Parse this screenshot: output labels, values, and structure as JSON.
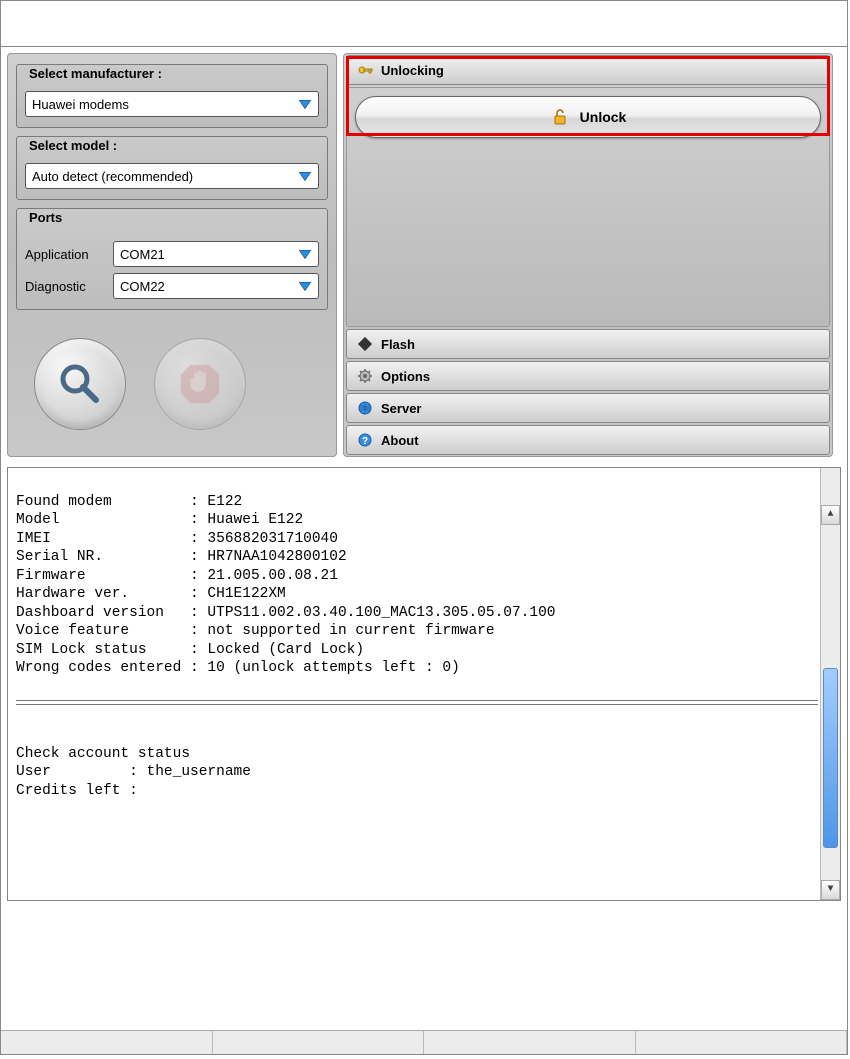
{
  "left": {
    "manufacturer": {
      "label": "Select manufacturer :",
      "value": "Huawei modems"
    },
    "model": {
      "label": "Select model :",
      "value": "Auto detect (recommended)"
    },
    "ports": {
      "label": "Ports",
      "application": {
        "label": "Application",
        "value": "COM21"
      },
      "diagnostic": {
        "label": "Diagnostic",
        "value": "COM22"
      }
    }
  },
  "right": {
    "sections": {
      "unlocking": "Unlocking",
      "flash": "Flash",
      "options": "Options",
      "server": "Server",
      "about": "About"
    },
    "unlock_button": "Unlock"
  },
  "log": {
    "header_lines": [
      "Found modem         : E122",
      "Model               : Huawei E122",
      "IMEI                : 356882031710040",
      "Serial NR.          : HR7NAA1042800102",
      "Firmware            : 21.005.00.08.21",
      "Hardware ver.       : CH1E122XM",
      "Dashboard version   : UTPS11.002.03.40.100_MAC13.305.05.07.100",
      "Voice feature       : not supported in current firmware",
      "SIM Lock status     : Locked (Card Lock)",
      "Wrong codes entered : 10 (unlock attempts left : 0)"
    ],
    "footer_lines": [
      "Check account status",
      "User         : the_username",
      "Credits left :"
    ]
  }
}
